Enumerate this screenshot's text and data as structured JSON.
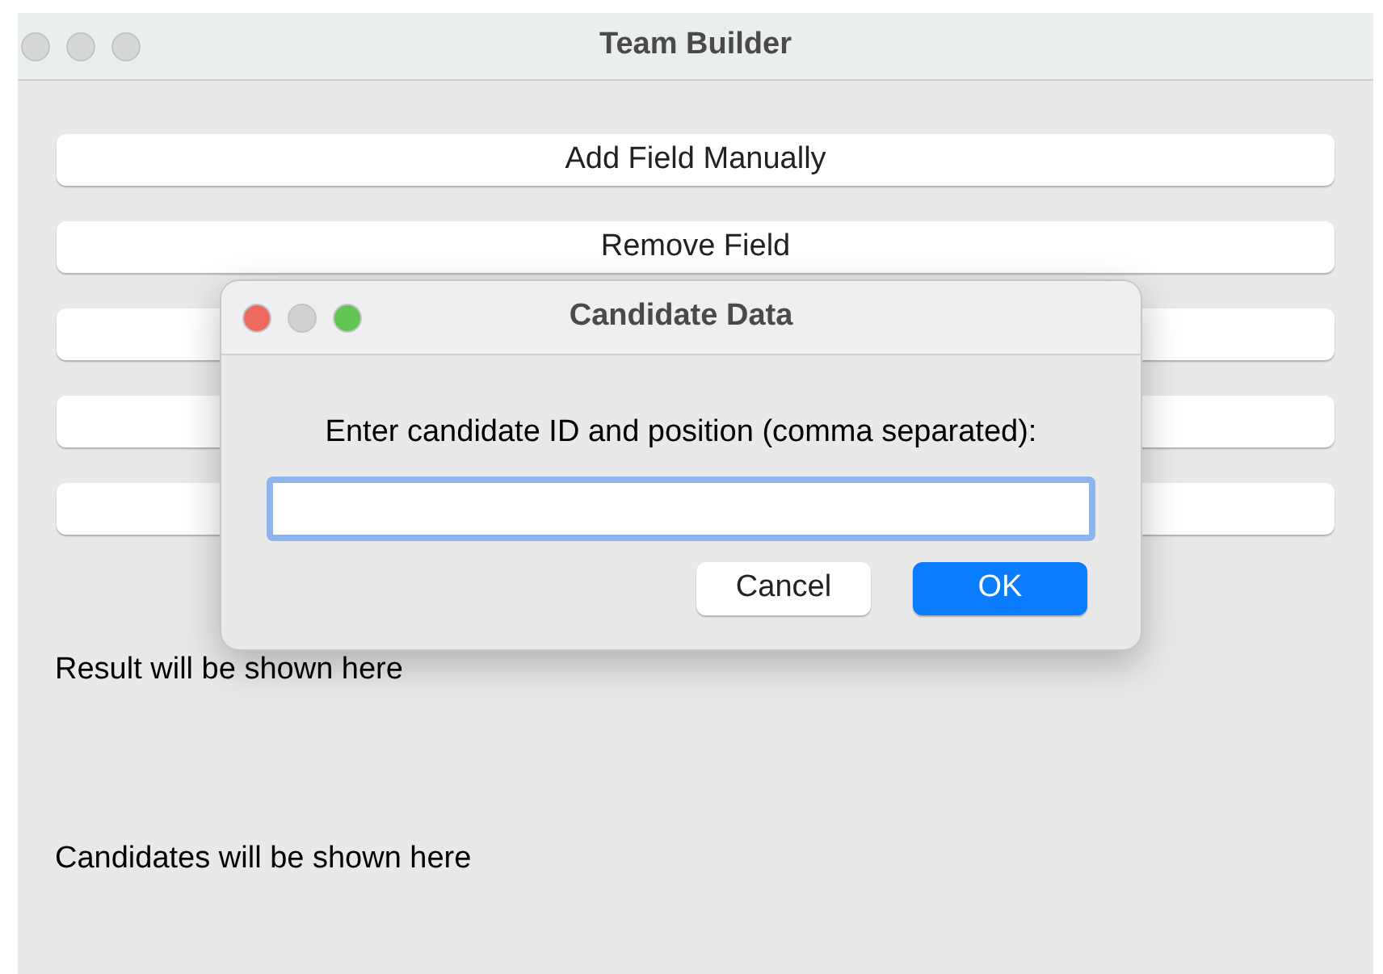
{
  "window": {
    "title": "Team Builder"
  },
  "buttons": [
    {
      "kind": "labeled",
      "label": "Add Field Manually"
    },
    {
      "kind": "labeled",
      "label": "Remove Field"
    },
    {
      "kind": "covered"
    },
    {
      "kind": "covered"
    },
    {
      "kind": "covered"
    }
  ],
  "result_text": "Result will be shown here",
  "candidates_text": "Candidates will be shown here",
  "dialog": {
    "title": "Candidate Data",
    "prompt": "Enter candidate ID and position (comma separated):",
    "input": {
      "focused": true
    },
    "buttons": [
      {
        "label": "Cancel",
        "kind": "default"
      },
      {
        "label": "OK",
        "kind": "primary"
      }
    ]
  }
}
